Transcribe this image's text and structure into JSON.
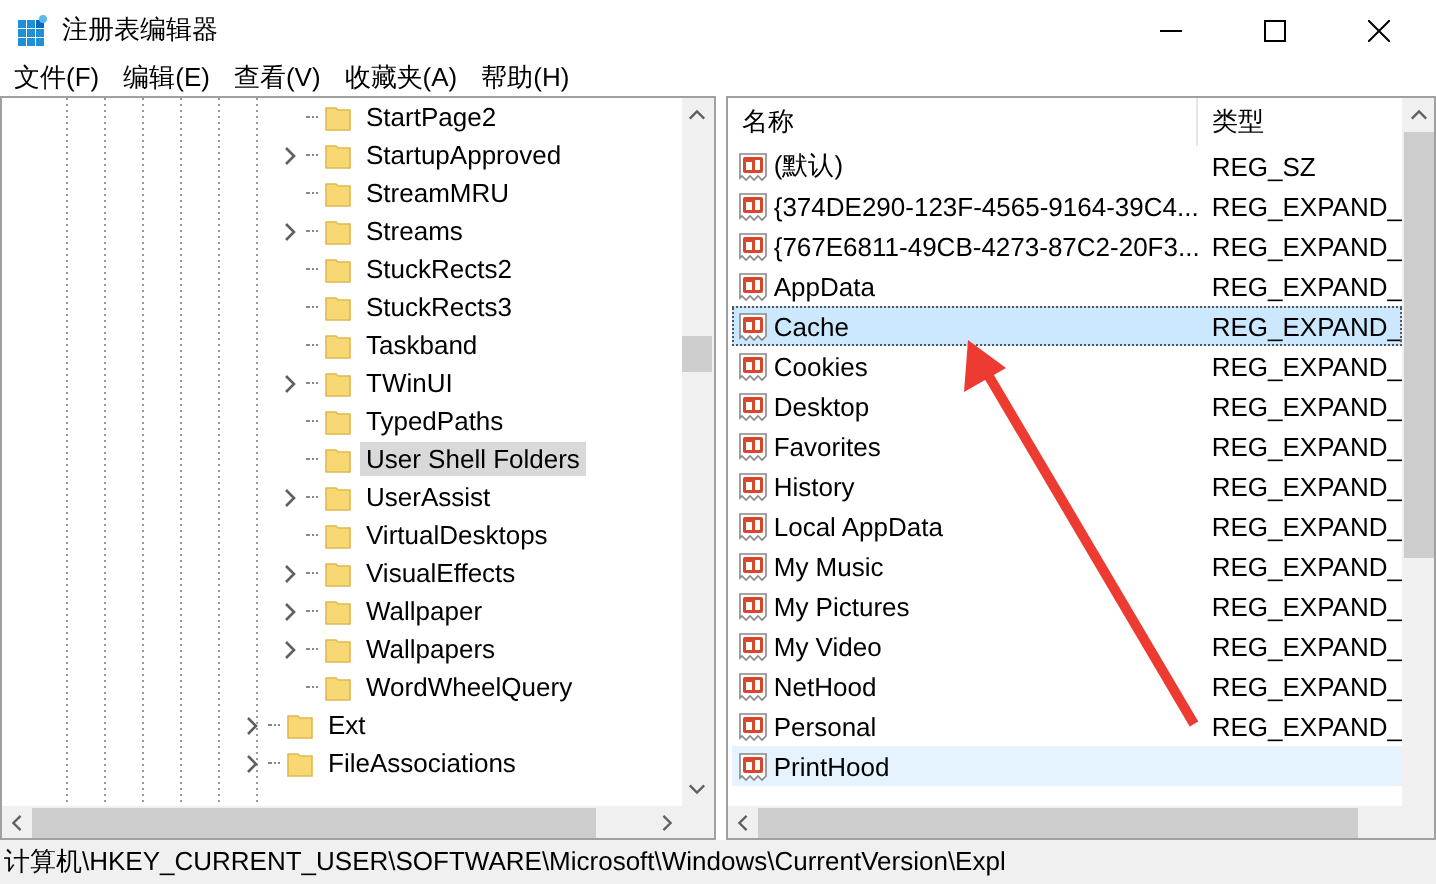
{
  "window": {
    "title": "注册表编辑器"
  },
  "menu": [
    "文件(F)",
    "编辑(E)",
    "查看(V)",
    "收藏夹(A)",
    "帮助(H)"
  ],
  "tree": {
    "nodes": [
      {
        "children": [
          {
            "label": "StartPage2",
            "expandable": false,
            "selected": false
          },
          {
            "label": "StartupApproved",
            "expandable": true,
            "selected": false
          },
          {
            "label": "StreamMRU",
            "expandable": false,
            "selected": false
          },
          {
            "label": "Streams",
            "expandable": true,
            "selected": false
          },
          {
            "label": "StuckRects2",
            "expandable": false,
            "selected": false
          },
          {
            "label": "StuckRects3",
            "expandable": false,
            "selected": false
          },
          {
            "label": "Taskband",
            "expandable": false,
            "selected": false
          },
          {
            "label": "TWinUI",
            "expandable": true,
            "selected": false
          },
          {
            "label": "TypedPaths",
            "expandable": false,
            "selected": false
          },
          {
            "label": "User Shell Folders",
            "expandable": false,
            "selected": true
          },
          {
            "label": "UserAssist",
            "expandable": true,
            "selected": false
          },
          {
            "label": "VirtualDesktops",
            "expandable": false,
            "selected": false
          },
          {
            "label": "VisualEffects",
            "expandable": true,
            "selected": false
          },
          {
            "label": "Wallpaper",
            "expandable": true,
            "selected": false
          },
          {
            "label": "Wallpapers",
            "expandable": true,
            "selected": false
          },
          {
            "label": "WordWheelQuery",
            "expandable": false,
            "selected": false
          }
        ]
      },
      {
        "label": "Ext",
        "expandable": true,
        "selected": false
      },
      {
        "label": "FileAssociations",
        "expandable": true,
        "selected": false
      }
    ]
  },
  "values": {
    "columns": [
      "名称",
      "类型"
    ],
    "rows": [
      {
        "name": "(默认)",
        "type": "REG_SZ",
        "selected": false,
        "hovered": false
      },
      {
        "name": "{374DE290-123F-4565-9164-39C4...",
        "type": "REG_EXPAND_",
        "selected": false,
        "hovered": false
      },
      {
        "name": "{767E6811-49CB-4273-87C2-20F3...",
        "type": "REG_EXPAND_",
        "selected": false,
        "hovered": false
      },
      {
        "name": "AppData",
        "type": "REG_EXPAND_",
        "selected": false,
        "hovered": false
      },
      {
        "name": "Cache",
        "type": "REG_EXPAND_",
        "selected": true,
        "hovered": false
      },
      {
        "name": "Cookies",
        "type": "REG_EXPAND_",
        "selected": false,
        "hovered": false
      },
      {
        "name": "Desktop",
        "type": "REG_EXPAND_",
        "selected": false,
        "hovered": false
      },
      {
        "name": "Favorites",
        "type": "REG_EXPAND_",
        "selected": false,
        "hovered": false
      },
      {
        "name": "History",
        "type": "REG_EXPAND_",
        "selected": false,
        "hovered": false
      },
      {
        "name": "Local AppData",
        "type": "REG_EXPAND_",
        "selected": false,
        "hovered": false
      },
      {
        "name": "My Music",
        "type": "REG_EXPAND_",
        "selected": false,
        "hovered": false
      },
      {
        "name": "My Pictures",
        "type": "REG_EXPAND_",
        "selected": false,
        "hovered": false
      },
      {
        "name": "My Video",
        "type": "REG_EXPAND_",
        "selected": false,
        "hovered": false
      },
      {
        "name": "NetHood",
        "type": "REG_EXPAND_",
        "selected": false,
        "hovered": false
      },
      {
        "name": "Personal",
        "type": "REG_EXPAND_",
        "selected": false,
        "hovered": false
      },
      {
        "name": "PrintHood",
        "selected": false,
        "hovered": true
      }
    ]
  },
  "status_bar": "计算机\\HKEY_CURRENT_USER\\SOFTWARE\\Microsoft\\Windows\\CurrentVersion\\Expl"
}
